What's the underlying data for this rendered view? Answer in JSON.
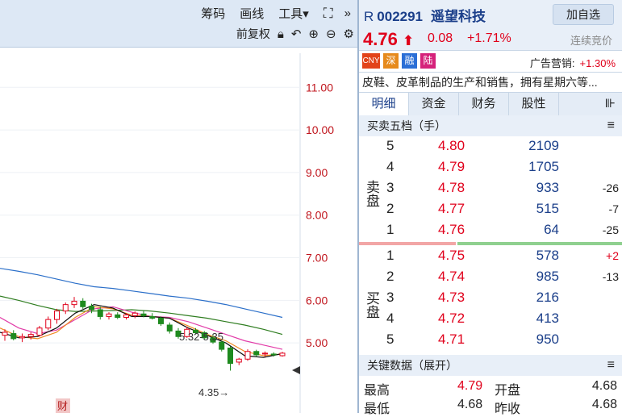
{
  "chart_toolbar": {
    "items": [
      "筹码",
      "画线",
      "工具▾"
    ],
    "row2_label": "前复权",
    "expand_icon": "fullscreen-icon",
    "more_icon": "double-chevron-icon"
  },
  "chart_data": {
    "type": "candlestick",
    "y_ticks": [
      "11.00",
      "10.00",
      "9.00",
      "8.00",
      "7.00",
      "6.00",
      "5.00"
    ],
    "y_range": [
      4.0,
      11.8
    ],
    "annotations": {
      "range_label": "5.32-5.35",
      "low_label": "4.35→",
      "event_marker": "财"
    },
    "candles": [
      {
        "o": 5.18,
        "h": 5.32,
        "l": 5.05,
        "c": 5.25
      },
      {
        "o": 5.22,
        "h": 5.3,
        "l": 5.06,
        "c": 5.1
      },
      {
        "o": 5.12,
        "h": 5.22,
        "l": 5.02,
        "c": 5.15
      },
      {
        "o": 5.15,
        "h": 5.25,
        "l": 5.08,
        "c": 5.2
      },
      {
        "o": 5.18,
        "h": 5.4,
        "l": 5.15,
        "c": 5.35
      },
      {
        "o": 5.35,
        "h": 5.62,
        "l": 5.3,
        "c": 5.55
      },
      {
        "o": 5.55,
        "h": 5.8,
        "l": 5.45,
        "c": 5.75
      },
      {
        "o": 5.75,
        "h": 5.95,
        "l": 5.68,
        "c": 5.9
      },
      {
        "o": 5.9,
        "h": 6.08,
        "l": 5.82,
        "c": 5.98
      },
      {
        "o": 5.98,
        "h": 6.05,
        "l": 5.8,
        "c": 5.85
      },
      {
        "o": 5.86,
        "h": 5.92,
        "l": 5.7,
        "c": 5.78
      },
      {
        "o": 5.78,
        "h": 5.85,
        "l": 5.55,
        "c": 5.62
      },
      {
        "o": 5.62,
        "h": 5.72,
        "l": 5.55,
        "c": 5.68
      },
      {
        "o": 5.66,
        "h": 5.72,
        "l": 5.56,
        "c": 5.6
      },
      {
        "o": 5.6,
        "h": 5.7,
        "l": 5.55,
        "c": 5.66
      },
      {
        "o": 5.64,
        "h": 5.74,
        "l": 5.58,
        "c": 5.7
      },
      {
        "o": 5.68,
        "h": 5.75,
        "l": 5.6,
        "c": 5.64
      },
      {
        "o": 5.62,
        "h": 5.7,
        "l": 5.55,
        "c": 5.58
      },
      {
        "o": 5.58,
        "h": 5.62,
        "l": 5.4,
        "c": 5.45
      },
      {
        "o": 5.42,
        "h": 5.48,
        "l": 5.22,
        "c": 5.28
      },
      {
        "o": 5.28,
        "h": 5.35,
        "l": 5.1,
        "c": 5.15
      },
      {
        "o": 5.15,
        "h": 5.38,
        "l": 5.12,
        "c": 5.32
      },
      {
        "o": 5.3,
        "h": 5.35,
        "l": 5.2,
        "c": 5.24
      },
      {
        "o": 5.24,
        "h": 5.28,
        "l": 5.08,
        "c": 5.12
      },
      {
        "o": 5.12,
        "h": 5.18,
        "l": 4.98,
        "c": 5.02
      },
      {
        "o": 5.02,
        "h": 5.05,
        "l": 4.8,
        "c": 4.85
      },
      {
        "o": 4.88,
        "h": 4.92,
        "l": 4.35,
        "c": 4.52
      },
      {
        "o": 4.55,
        "h": 4.65,
        "l": 4.48,
        "c": 4.62
      },
      {
        "o": 4.62,
        "h": 4.85,
        "l": 4.58,
        "c": 4.8
      },
      {
        "o": 4.8,
        "h": 4.84,
        "l": 4.68,
        "c": 4.72
      },
      {
        "o": 4.74,
        "h": 4.8,
        "l": 4.68,
        "c": 4.76
      },
      {
        "o": 4.74,
        "h": 4.78,
        "l": 4.68,
        "c": 4.72
      },
      {
        "o": 4.7,
        "h": 4.79,
        "l": 4.68,
        "c": 4.76
      }
    ],
    "ma_series": [
      {
        "color": "#2b6fc9",
        "values": [
          6.75,
          6.68,
          6.6,
          6.5,
          6.4,
          6.32,
          6.28,
          6.22,
          6.16,
          6.1,
          6.05,
          5.98,
          5.9,
          5.8,
          5.7,
          5.6
        ]
      },
      {
        "color": "#2f7d20",
        "values": [
          6.1,
          6.0,
          5.88,
          5.78,
          5.74,
          5.75,
          5.76,
          5.78,
          5.75,
          5.7,
          5.64,
          5.58,
          5.5,
          5.42,
          5.32,
          5.2
        ]
      },
      {
        "color": "#e23ca8",
        "values": [
          5.6,
          5.35,
          5.22,
          5.3,
          5.55,
          5.8,
          5.85,
          5.72,
          5.62,
          5.6,
          5.5,
          5.35,
          5.2,
          5.05,
          4.95,
          4.85
        ]
      },
      {
        "color": "#f08a24",
        "values": [
          5.35,
          5.15,
          5.1,
          5.25,
          5.6,
          5.85,
          5.8,
          5.65,
          5.62,
          5.58,
          5.4,
          5.2,
          5.05,
          4.8,
          4.7,
          4.74
        ]
      },
      {
        "color": "#111111",
        "values": [
          5.25,
          5.12,
          5.15,
          5.35,
          5.7,
          5.9,
          5.82,
          5.62,
          5.62,
          5.58,
          5.35,
          5.18,
          5.0,
          4.7,
          4.66,
          4.75
        ]
      }
    ]
  },
  "quote": {
    "market_letter": "R",
    "code": "002291",
    "name": "遥望科技",
    "add_button": "加自选",
    "price": "4.76",
    "change": "0.08",
    "change_pct": "+1.71%",
    "status": "连续竞价",
    "tags": [
      {
        "text": "CNY",
        "color": "#e2431a"
      },
      {
        "text": "深",
        "color": "#e68a1c"
      },
      {
        "text": "融",
        "color": "#2b6fd6"
      },
      {
        "text": "陆",
        "color": "#d5227a"
      }
    ],
    "ad_label": "广告营销:",
    "ad_value": "+1.30%",
    "description": "皮鞋、皮革制品的生产和销售，拥有星期六等..."
  },
  "tabs": [
    "明细",
    "资金",
    "财务",
    "股性"
  ],
  "order_book": {
    "title": "买卖五档（手）",
    "sell_label": "卖盘",
    "buy_label": "买盘",
    "asks": [
      {
        "level": "5",
        "price": "4.80",
        "vol": "2109",
        "delta": ""
      },
      {
        "level": "4",
        "price": "4.79",
        "vol": "1705",
        "delta": ""
      },
      {
        "level": "3",
        "price": "4.78",
        "vol": "933",
        "delta": "-26"
      },
      {
        "level": "2",
        "price": "4.77",
        "vol": "515",
        "delta": "-7"
      },
      {
        "level": "1",
        "price": "4.76",
        "vol": "64",
        "delta": "-25"
      }
    ],
    "bids": [
      {
        "level": "1",
        "price": "4.75",
        "vol": "578",
        "delta": "+2"
      },
      {
        "level": "2",
        "price": "4.74",
        "vol": "985",
        "delta": "-13"
      },
      {
        "level": "3",
        "price": "4.73",
        "vol": "216",
        "delta": ""
      },
      {
        "level": "4",
        "price": "4.72",
        "vol": "413",
        "delta": ""
      },
      {
        "level": "5",
        "price": "4.71",
        "vol": "950",
        "delta": ""
      }
    ]
  },
  "key_data": {
    "title": "关键数据（展开）",
    "rows": [
      {
        "k1": "最高",
        "v1": "4.79",
        "k2": "开盘",
        "v2": "4.68"
      },
      {
        "k1": "最低",
        "v1": "4.68",
        "k2": "昨收",
        "v2": "4.68"
      }
    ]
  }
}
